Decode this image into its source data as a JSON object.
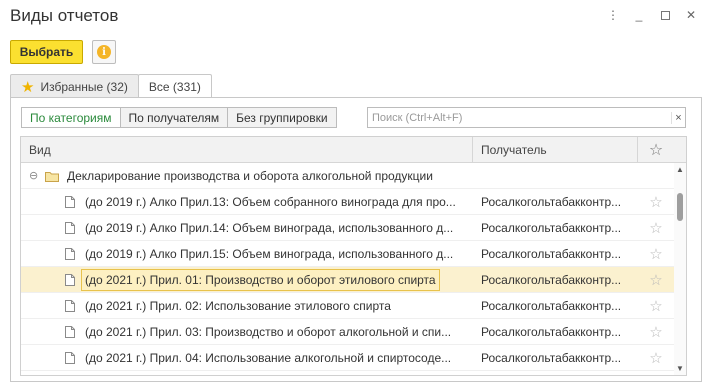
{
  "window": {
    "title": "Виды отчетов"
  },
  "toolbar": {
    "select_label": "Выбрать"
  },
  "tabs": [
    {
      "label": "Избранные (32)"
    },
    {
      "label": "Все (331)"
    }
  ],
  "grouping": {
    "by_category": "По категориям",
    "by_recipient": "По получателям",
    "no_grouping": "Без группировки"
  },
  "search": {
    "placeholder": "Поиск (Ctrl+Alt+F)",
    "value": ""
  },
  "table": {
    "headers": {
      "name": "Вид",
      "recipient": "Получатель"
    },
    "group": {
      "label": "Декларирование производства и оборота алкогольной продукции"
    },
    "rows": [
      {
        "name": "(до 2019 г.) Алко Прил.13: Объем собранного винограда для про...",
        "recipient": "Росалкогольтабакконтр..."
      },
      {
        "name": "(до 2019 г.) Алко Прил.14: Объем винограда, использованного д...",
        "recipient": "Росалкогольтабакконтр..."
      },
      {
        "name": "(до 2019 г.) Алко Прил.15: Объем винограда, использованного д...",
        "recipient": "Росалкогольтабакконтр..."
      },
      {
        "name": "(до 2021 г.) Прил. 01: Производство и оборот этилового спирта",
        "recipient": "Росалкогольтабакконтр..."
      },
      {
        "name": "(до 2021 г.) Прил. 02: Использование этилового спирта",
        "recipient": "Росалкогольтабакконтр..."
      },
      {
        "name": "(до 2021 г.) Прил. 03: Производство и оборот алкогольной и спи...",
        "recipient": "Росалкогольтабакконтр..."
      },
      {
        "name": "(до 2021 г.) Прил. 04: Использование алкогольной и спиртосоде...",
        "recipient": "Росалкогольтабакконтр..."
      }
    ]
  }
}
